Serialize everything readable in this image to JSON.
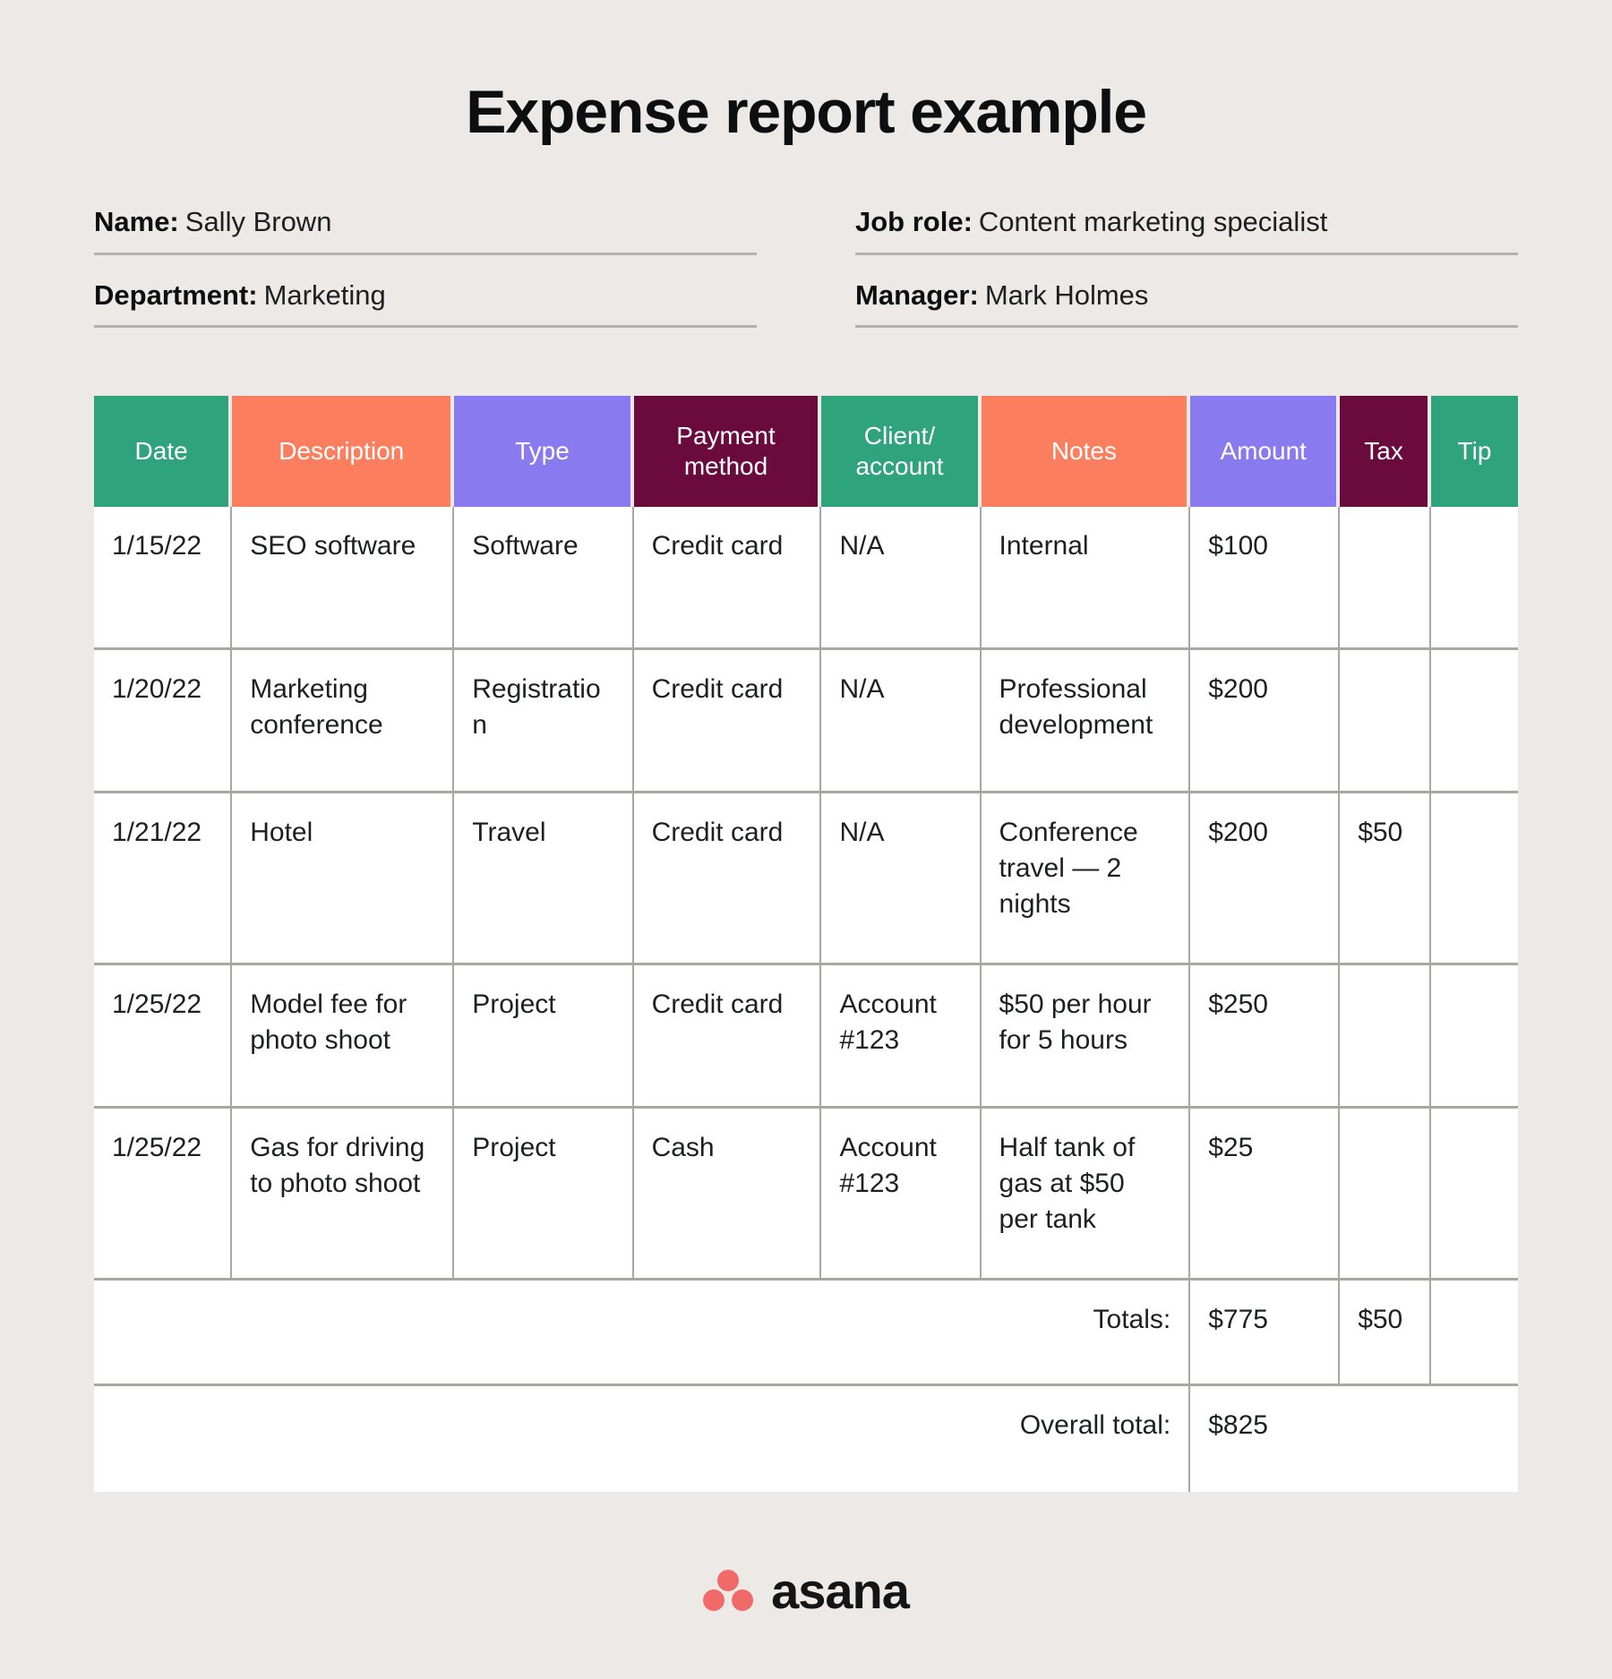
{
  "document": {
    "title": "Expense report example"
  },
  "meta": {
    "left": [
      {
        "label": "Name:",
        "value": "Sally Brown"
      },
      {
        "label": "Department:",
        "value": "Marketing"
      }
    ],
    "right": [
      {
        "label": "Job role:",
        "value": "Content marketing specialist"
      },
      {
        "label": "Manager:",
        "value": "Mark Holmes"
      }
    ]
  },
  "table": {
    "headers": [
      {
        "label": "Date",
        "color": "#2ea37c"
      },
      {
        "label": "Description",
        "color": "#fb7e5e"
      },
      {
        "label": "Type",
        "color": "#8a7af0"
      },
      {
        "label": "Payment method",
        "color": "#6b0a3c"
      },
      {
        "label": "Client/ account",
        "color": "#2ea37c"
      },
      {
        "label": "Notes",
        "color": "#fb7e5e"
      },
      {
        "label": "Amount",
        "color": "#8a7af0"
      },
      {
        "label": "Tax",
        "color": "#6b0a3c"
      },
      {
        "label": "Tip",
        "color": "#2ea37c"
      }
    ],
    "header_lines": {
      "payment_method_1": "Payment",
      "payment_method_2": "method",
      "client_account_1": "Client/",
      "client_account_2": "account"
    },
    "rows": [
      {
        "date": "1/15/22",
        "description": "SEO software",
        "type": "Software",
        "payment_method": "Credit card",
        "client_account": "N/A",
        "notes": "Internal",
        "amount": "$100",
        "tax": "",
        "tip": ""
      },
      {
        "date": "1/20/22",
        "description": "Marketing conference",
        "type": "Registration",
        "payment_method": "Credit card",
        "client_account": "N/A",
        "notes": "Professional development",
        "amount": "$200",
        "tax": "",
        "tip": ""
      },
      {
        "date": "1/21/22",
        "description": "Hotel",
        "type": "Travel",
        "payment_method": "Credit card",
        "client_account": "N/A",
        "notes": "Conference travel — 2 nights",
        "amount": "$200",
        "tax": "$50",
        "tip": ""
      },
      {
        "date": "1/25/22",
        "description": "Model fee for photo shoot",
        "type": "Project",
        "payment_method": "Credit card",
        "client_account": "Account #123",
        "notes": "$50 per hour for 5 hours",
        "amount": "$250",
        "tax": "",
        "tip": ""
      },
      {
        "date": "1/25/22",
        "description": "Gas for driving to photo shoot",
        "type": "Project",
        "payment_method": "Cash",
        "client_account": "Account #123",
        "notes": "Half tank of gas at $50 per tank",
        "amount": "$25",
        "tax": "",
        "tip": ""
      }
    ],
    "totals": {
      "label": "Totals:",
      "amount": "$775",
      "tax": "$50",
      "tip": ""
    },
    "overall": {
      "label": "Overall total:",
      "amount": "$825"
    }
  },
  "footer": {
    "brand": "asana"
  },
  "colors": {
    "background": "#ece9e6",
    "green": "#2ea37c",
    "coral": "#fb7e5e",
    "purple": "#8a7af0",
    "maroon": "#6b0a3c",
    "grid": "#a9a6a3",
    "brand_red": "#f06a6a",
    "text": "#1e1f21"
  }
}
